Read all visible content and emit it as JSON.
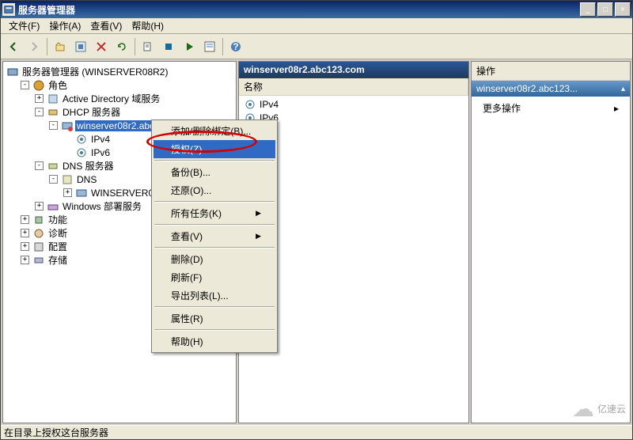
{
  "title": "服务器管理器",
  "menus": [
    "文件(F)",
    "操作(A)",
    "查看(V)",
    "帮助(H)"
  ],
  "tree": {
    "root": "服务器管理器 (WINSERVER08R2)",
    "roles": "角色",
    "ad": "Active Directory 域服务",
    "dhcp": "DHCP 服务器",
    "dhcp_host": "winserver08r2.abc123.com",
    "ipv4": "IPv4",
    "ipv6": "IPv6",
    "dns": "DNS 服务器",
    "dns_sub": "DNS",
    "dns_host": "WINSERVER08R2",
    "wds": "Windows 部署服务",
    "features": "功能",
    "diag": "诊断",
    "config": "配置",
    "storage": "存储"
  },
  "mid": {
    "header": "winserver08r2.abc123.com",
    "col": "名称",
    "items": [
      "IPv4",
      "IPv6"
    ]
  },
  "right": {
    "header": "操作",
    "sub": "winserver08r2.abc123...",
    "more": "更多操作",
    "arrow": "▸"
  },
  "ctx": {
    "addremove": "添加/删除绑定(B)...",
    "authorize": "授权(Z)",
    "backup": "备份(B)...",
    "restore": "还原(O)...",
    "alltasks": "所有任务(K)",
    "view": "查看(V)",
    "delete": "删除(D)",
    "refresh": "刷新(F)",
    "export": "导出列表(L)...",
    "props": "属性(R)",
    "help": "帮助(H)"
  },
  "status": "在目录上授权这台服务器",
  "watermark": "亿速云",
  "colors": {
    "selection": "#316ac5",
    "titlebar": "#0a246a"
  }
}
